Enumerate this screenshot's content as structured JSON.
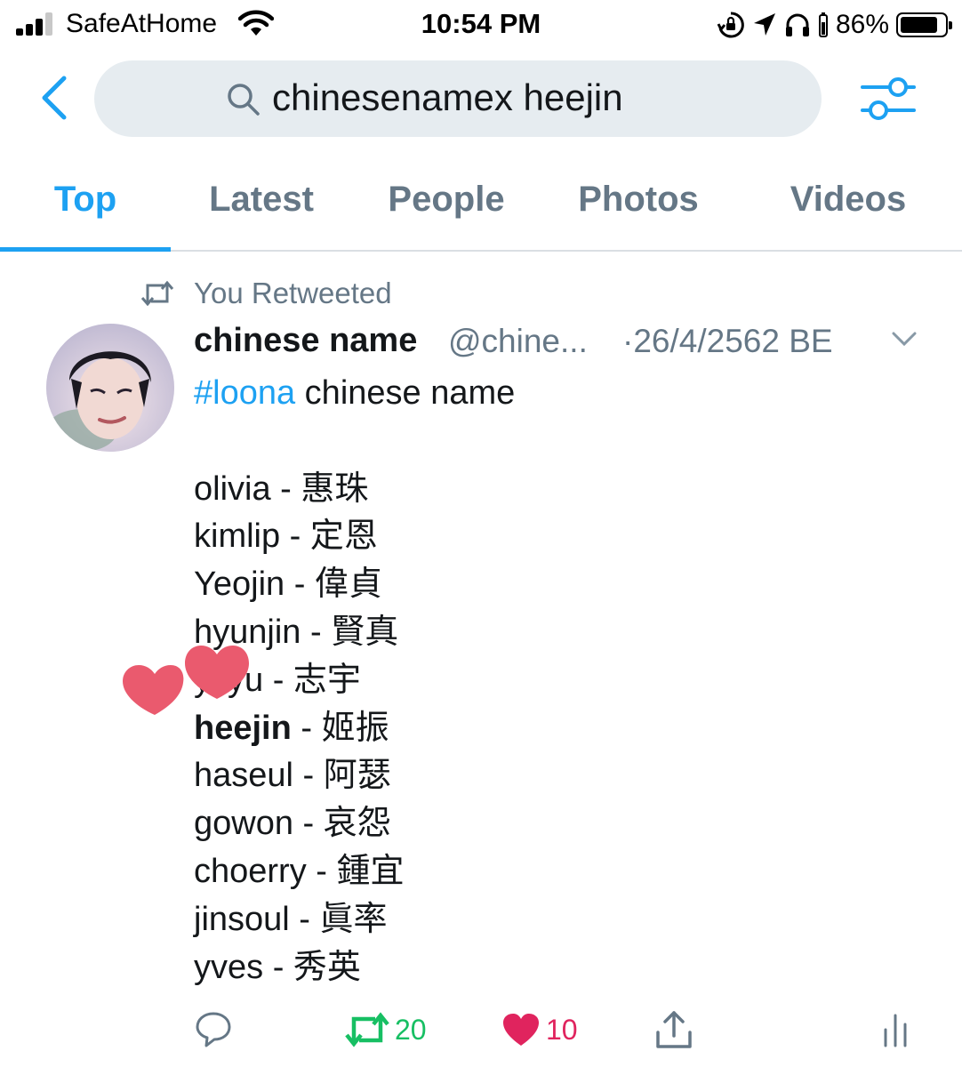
{
  "status_bar": {
    "carrier": "SafeAtHome",
    "time": "10:54 PM",
    "battery": "86%",
    "battery_level": 0.86,
    "icons": [
      "signal-icon",
      "wifi-icon",
      "orientation-lock-icon",
      "location-arrow-icon",
      "headphones-icon",
      "battery-icon"
    ]
  },
  "search": {
    "query": "chinesenamex heejin",
    "back_icon": "chevron-left-icon",
    "search_icon": "magnifier-icon",
    "filter_icon": "sliders-icon"
  },
  "tabs": [
    {
      "label": "Top",
      "active": true
    },
    {
      "label": "Latest",
      "active": false
    },
    {
      "label": "People",
      "active": false
    },
    {
      "label": "Photos",
      "active": false
    },
    {
      "label": "Videos",
      "active": false
    }
  ],
  "tweet": {
    "retweet_label": "You Retweeted",
    "author_name": "chinese name",
    "author_handle": "@chine...",
    "date": "·26/4/2562 BE",
    "hashtag": "#loona",
    "headline_rest": " chinese name",
    "lines": [
      {
        "name": "olivia",
        "sep": " - ",
        "value": "惠珠"
      },
      {
        "name": "kimlip",
        "sep": " - ",
        "value": "定恩"
      },
      {
        "name": "Yeojin",
        "sep": " - ",
        "value": "偉貞"
      },
      {
        "name": "hyunjin",
        "sep": " - ",
        "value": "賢真"
      },
      {
        "name": "yvyu",
        "sep": " - ",
        "value": "志宇"
      },
      {
        "name": "heejin",
        "sep": " - ",
        "value": "姬振"
      },
      {
        "name": "haseul",
        "sep": " - ",
        "value": "阿瑟"
      },
      {
        "name": "gowon",
        "sep": " - ",
        "value": "哀怨"
      },
      {
        "name": "choerry",
        "sep": " - ",
        "value": "鍾宜"
      },
      {
        "name": "jinsoul",
        "sep": " - ",
        "value": "眞率"
      },
      {
        "name": "yves",
        "sep": " - ",
        "value": "秀英"
      }
    ],
    "actions": {
      "reply_count": "",
      "retweet_count": "20",
      "like_count": "10"
    }
  },
  "colors": {
    "accent": "#1da1f2",
    "muted": "#657786",
    "retweet_active": "#17bf63",
    "like_active": "#e0245e",
    "heart_sticker": "#ea5a6e"
  }
}
